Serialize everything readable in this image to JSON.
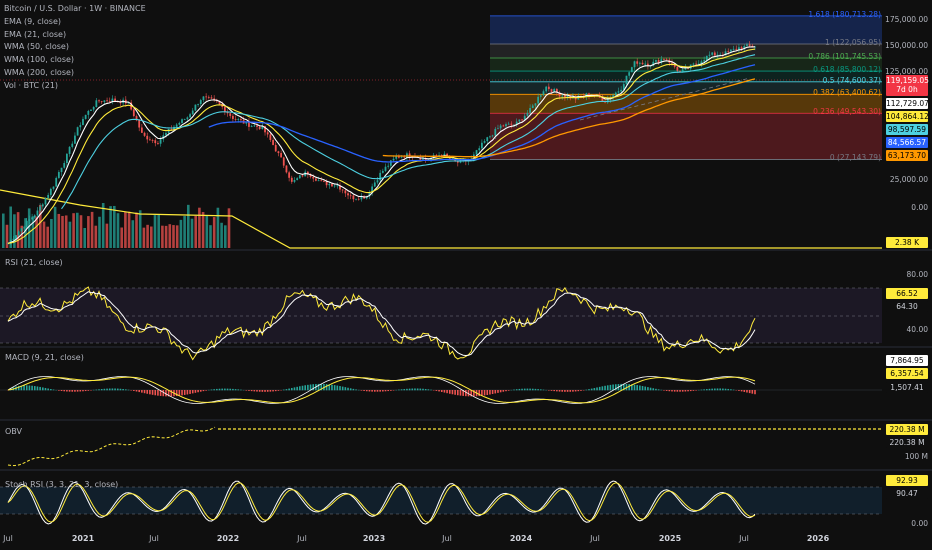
{
  "legend": {
    "title": "Bitcoin / U.S. Dollar · 1W · BINANCE",
    "lines": [
      "EMA (9, close)",
      "EMA (21, close)",
      "WMA (50, close)",
      "WMA (100, close)",
      "WMA (200, close)",
      "Vol · BTC (21)"
    ]
  },
  "panes": {
    "rsi": "RSI (21, close)",
    "macd": "MACD (9, 21, close)",
    "obv": "OBV",
    "stoch": "Stoch RSI (3, 3, 21, 3, close)"
  },
  "price_axis": [
    "175,000.00",
    "150,000.00",
    "125,000.00",
    "25,000.00",
    "0.00"
  ],
  "rsi_axis": [
    "80.00",
    "40.00"
  ],
  "obv_axis": [
    "100 M"
  ],
  "stoch_axis": [
    "0.00"
  ],
  "tags": {
    "price": "119,159.05",
    "price_sub": "7d 0h",
    "p1": "112,729.07",
    "p2": "104,864.12",
    "p3": "98,597.59",
    "p4": "84,566.57",
    "p5": "63,173.70",
    "vol": "2.38 K",
    "rsi1": "66.52",
    "rsi2": "64.30",
    "macd1": "7,864.95",
    "macd2": "6,357.54",
    "macd3": "1,507.41",
    "obv1": "220.38 M",
    "obv2": "220.38 M",
    "stoch1": "92.93",
    "stoch2": "90.47"
  },
  "colors": {
    "tag_price": "#f23645",
    "tag_white": "#ffffff",
    "tag_yellow": "#ffeb3b",
    "tag_cyan": "#4dd0e1",
    "tag_blue": "#2962ff",
    "tag_orange": "#ff9800",
    "up": "#26a69a",
    "down": "#ef5350"
  },
  "chart_data": {
    "type": "line",
    "symbol": "Bitcoin / U.S. Dollar",
    "interval": "1W",
    "exchange": "BINANCE",
    "x_ticks": [
      "Jul",
      "2021",
      "Jul",
      "2022",
      "Jul",
      "2023",
      "Jul",
      "2024",
      "Jul",
      "2025",
      "Jul",
      "2026"
    ],
    "fib_levels": [
      {
        "label": "1.618 (180,713.28)",
        "ratio": 1.618,
        "price": 180713.28
      },
      {
        "label": "1 (122,056.95)",
        "ratio": 1,
        "price": 122056.95
      },
      {
        "label": "0.786 (101,745.53)",
        "ratio": 0.786,
        "price": 101745.53
      },
      {
        "label": "0.618 (85,800.12)",
        "ratio": 0.618,
        "price": 85800.12
      },
      {
        "label": "0.5 (74,600.37)",
        "ratio": 0.5,
        "price": 74600.37
      },
      {
        "label": "0.382 (63,400.62)",
        "ratio": 0.382,
        "price": 63400.62
      },
      {
        "label": "0.236 (49,543.30)",
        "ratio": 0.236,
        "price": 49543.3
      },
      {
        "label": "0 (27,143.79)",
        "ratio": 0,
        "price": 27143.79
      }
    ],
    "price_close_approx": [
      9100,
      11300,
      13800,
      19000,
      29000,
      46000,
      58000,
      59000,
      57000,
      37000,
      34000,
      41000,
      47000,
      61000,
      57000,
      47000,
      43000,
      41000,
      30000,
      20000,
      23000,
      20000,
      19500,
      16500,
      16800,
      23000,
      28000,
      29000,
      27000,
      29200,
      26000,
      27000,
      35000,
      42000,
      43000,
      52000,
      70000,
      63000,
      60000,
      64000,
      58000,
      68000,
      97000,
      94000,
      102000,
      84000,
      94000,
      106000,
      108000,
      117000,
      119159
    ],
    "rsi_range": [
      40,
      80
    ],
    "rsi_last": [
      66.52,
      64.3
    ],
    "macd_last": [
      7864.95,
      6357.54,
      1507.41
    ],
    "obv_last": "220.38 M",
    "stoch_last": [
      92.93,
      90.47
    ]
  }
}
